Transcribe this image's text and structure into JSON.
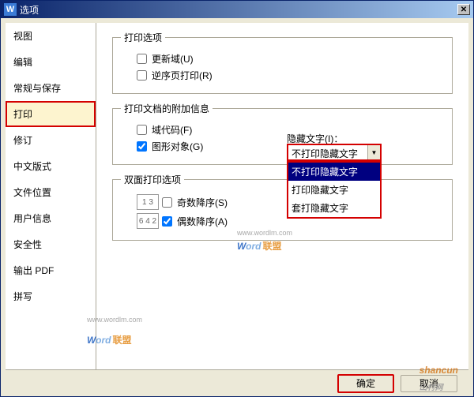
{
  "title": "选项",
  "appIcon": "W",
  "closeIcon": "✕",
  "sidebar": {
    "items": [
      {
        "label": "视图"
      },
      {
        "label": "编辑"
      },
      {
        "label": "常规与保存"
      },
      {
        "label": "打印",
        "active": true
      },
      {
        "label": "修订"
      },
      {
        "label": "中文版式"
      },
      {
        "label": "文件位置"
      },
      {
        "label": "用户信息"
      },
      {
        "label": "安全性"
      },
      {
        "label": "输出 PDF"
      },
      {
        "label": "拼写"
      }
    ]
  },
  "groups": {
    "printOptions": {
      "legend": "打印选项",
      "updateFields": "更新域(U)",
      "reversePages": "逆序页打印(R)"
    },
    "additionalInfo": {
      "legend": "打印文档的附加信息",
      "fieldCodes": "域代码(F)",
      "graphics": "图形对象(G)",
      "hiddenTextLabel": "隐藏文字(I)：",
      "hiddenTextSelected": "不打印隐藏文字",
      "hiddenTextOptions": [
        "不打印隐藏文字",
        "打印隐藏文字",
        "套打隐藏文字"
      ]
    },
    "duplex": {
      "legend": "双面打印选项",
      "oddReverse": "奇数降序(S)",
      "evenReverse": "偶数降序(A)"
    }
  },
  "buttons": {
    "ok": "确定",
    "cancel": "取消"
  },
  "watermark": {
    "word": "Word",
    "lm": "联盟",
    "url": "www.wordlm.com",
    "sc": "shancun",
    "scSuffix": "山村网"
  },
  "icons": {
    "oddIcon": "1 3",
    "evenIcon": "6 4 2"
  }
}
